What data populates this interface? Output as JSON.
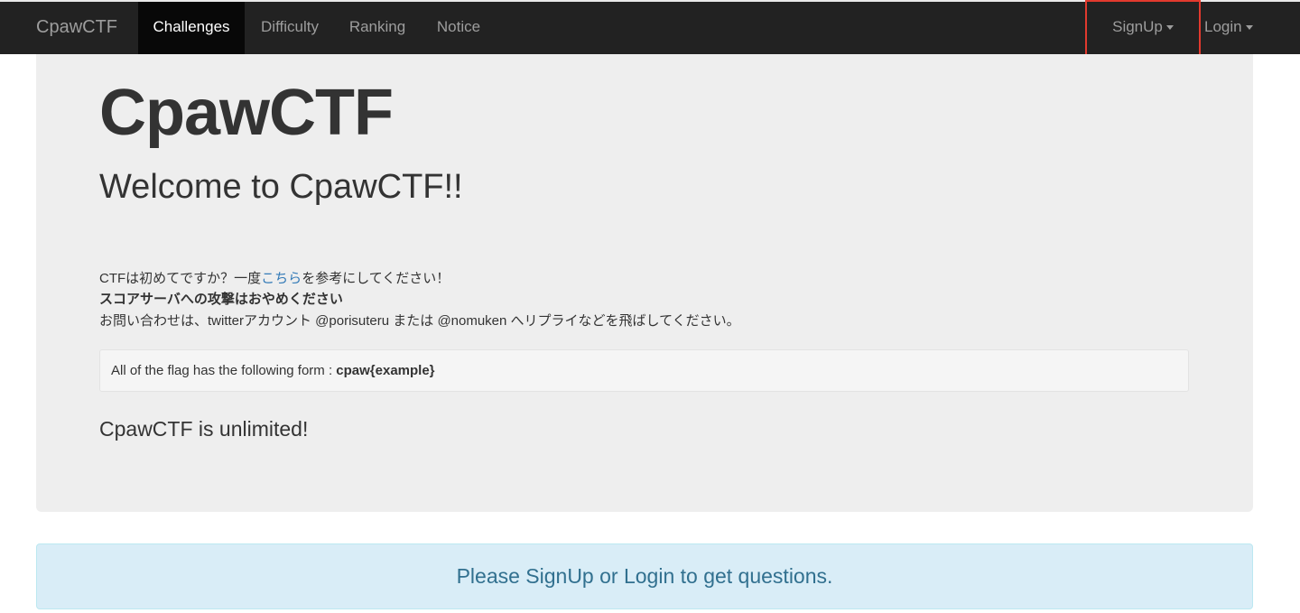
{
  "navbar": {
    "brand": "CpawCTF",
    "items": [
      {
        "label": "Challenges",
        "active": true
      },
      {
        "label": "Difficulty",
        "active": false
      },
      {
        "label": "Ranking",
        "active": false
      },
      {
        "label": "Notice",
        "active": false
      }
    ],
    "right": {
      "signup_label": "SignUp",
      "login_label": "Login"
    },
    "colors": {
      "background": "#222222",
      "active_background": "#080808",
      "highlight": "#e23a2e"
    }
  },
  "jumbotron": {
    "title": "CpawCTF",
    "welcome": "Welcome to CpawCTF!!",
    "line1_before": "CTFは初めてですか？一度",
    "line1_link": "こちら",
    "line1_after": "を参考にしてください！",
    "line2": "スコアサーバへの攻撃はおやめください",
    "line3": "お問い合わせは、twitterアカウント @porisuteru または @nomuken へリプライなどを飛ばしてください。",
    "well_text": "All of the flag has the following form : ",
    "flag_format": "cpaw{example}",
    "unlimited": "CpawCTF is unlimited!"
  },
  "alert": {
    "message": "Please SignUp or Login to get questions."
  }
}
